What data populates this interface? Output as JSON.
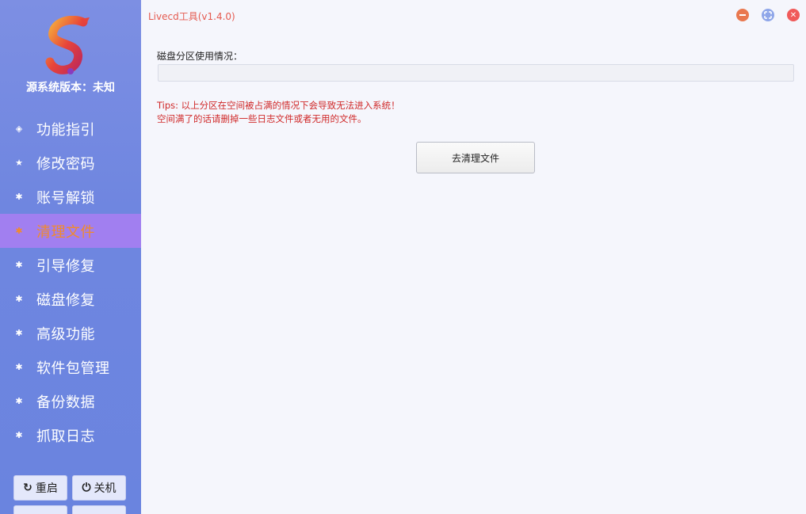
{
  "window": {
    "title": "Livecd工具(v1.4.0)",
    "controls": [
      "minimize-icon",
      "maximize-icon",
      "close-icon"
    ]
  },
  "sidebar": {
    "version_text": "源系统版本：未知",
    "items": [
      {
        "label": "功能指引",
        "icon": "cube-icon"
      },
      {
        "label": "修改密码",
        "icon": "star-icon"
      },
      {
        "label": "账号解锁",
        "icon": "bug-icon"
      },
      {
        "label": "清理文件",
        "icon": "bug-icon",
        "active": true
      },
      {
        "label": "引导修复",
        "icon": "bug-icon"
      },
      {
        "label": "磁盘修复",
        "icon": "bug-icon"
      },
      {
        "label": "高级功能",
        "icon": "bug-icon"
      },
      {
        "label": "软件包管理",
        "icon": "bug-icon"
      },
      {
        "label": "备份数据",
        "icon": "bug-icon"
      },
      {
        "label": "抓取日志",
        "icon": "bug-icon"
      }
    ],
    "system_buttons": [
      {
        "label": "重启",
        "icon": "restart-icon"
      },
      {
        "label": "关机",
        "icon": "power-icon"
      }
    ]
  },
  "main": {
    "disk_usage_label": "磁盘分区使用情况：",
    "disk_usage_fraction": 0,
    "tips_line1": "Tips: 以上分区在空间被占满的情况下会导致无法进入系统！",
    "tips_line2": "空间满了的话请删掉一些日志文件或者无用的文件。",
    "clean_button_label": "去清理文件"
  },
  "colors": {
    "sidebar_bg": "#6f86e0",
    "active_item_bg": "#a17ff0",
    "active_item_text": "#f08a2e",
    "title_text": "#e55a4f",
    "tips_text": "#d02a2a"
  }
}
